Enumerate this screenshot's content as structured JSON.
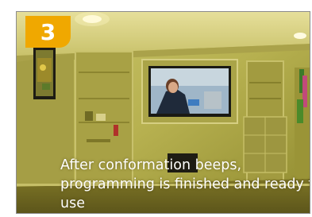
{
  "step": {
    "number": "3"
  },
  "caption": {
    "text": "After conformation beeps, programming is finished and ready to use"
  },
  "colors": {
    "badge": "#f0a800",
    "caption_text": "#ffffff"
  }
}
